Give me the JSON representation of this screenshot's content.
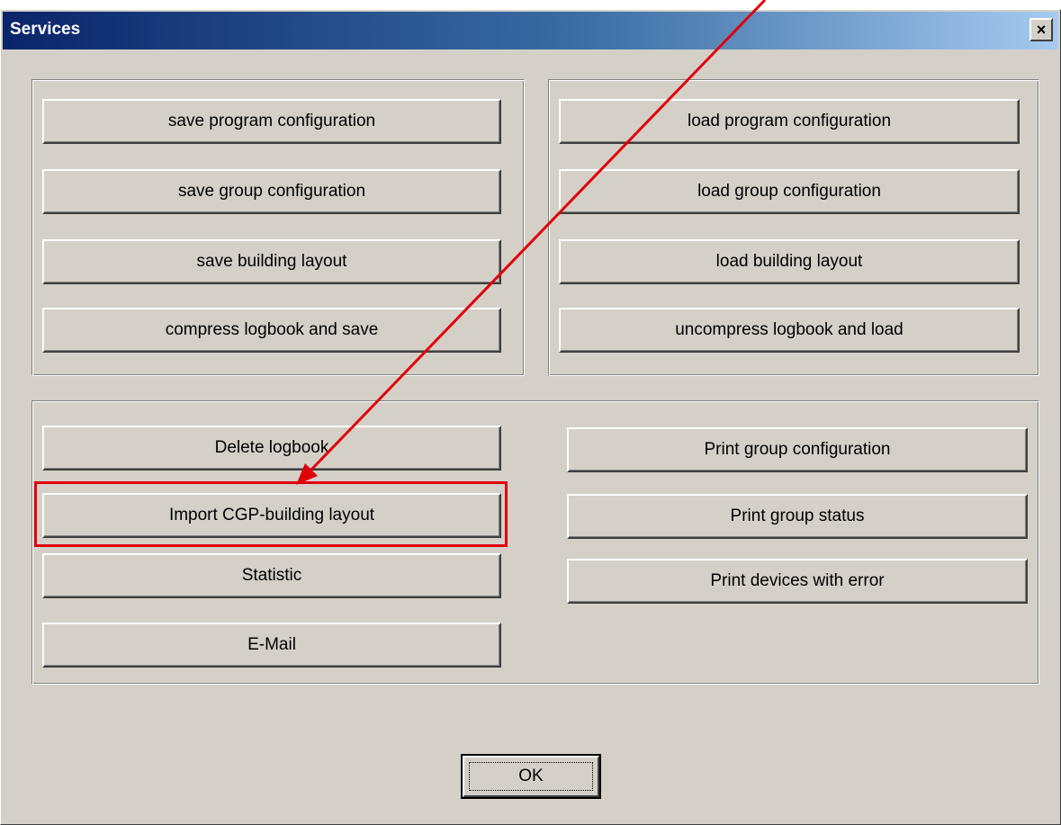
{
  "window": {
    "title": "Services",
    "close_label": "×"
  },
  "save_group": {
    "buttons": [
      "save program configuration",
      "save group configuration",
      "save building layout",
      "compress logbook and save"
    ]
  },
  "load_group": {
    "buttons": [
      "load program configuration",
      "load group configuration",
      "load building layout",
      "uncompress logbook and load"
    ]
  },
  "tools_group": {
    "left_buttons": [
      "Delete logbook",
      "Import CGP-building layout",
      "Statistic",
      "E-Mail"
    ],
    "right_buttons": [
      "Print group configuration",
      "Print group status",
      "Print devices with error"
    ]
  },
  "ok_label": "OK",
  "annotation": {
    "color": "#e0000b",
    "highlighted_item": "Import CGP-building layout"
  }
}
